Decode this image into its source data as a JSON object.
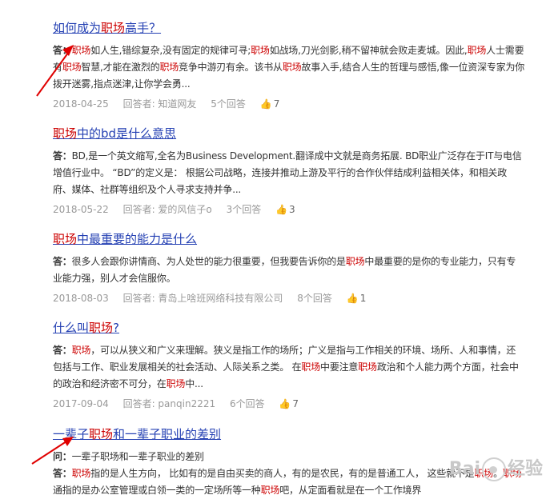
{
  "results": [
    {
      "title_parts": [
        "如何成为",
        "职场",
        "高手？"
      ],
      "body": [
        {
          "t": "答：",
          "c": "lbl"
        },
        {
          "t": "职场",
          "c": "hl"
        },
        {
          "t": "如人生,错综复杂,没有固定的规律可寻;"
        },
        {
          "t": "职场",
          "c": "hl"
        },
        {
          "t": "如战场,刀光剑影,稍不留神就会败走麦城。因此,"
        },
        {
          "t": "职场",
          "c": "hl"
        },
        {
          "t": "人士需要有"
        },
        {
          "t": "职场",
          "c": "hl"
        },
        {
          "t": "智慧,才能在激烈的"
        },
        {
          "t": "职场",
          "c": "hl"
        },
        {
          "t": "竞争中游刃有余。该书从"
        },
        {
          "t": "职场",
          "c": "hl"
        },
        {
          "t": "故事入手,结合人生的哲理与感悟,像一位资深专家为你拨开迷雾,指点迷津,让你学会勇..."
        }
      ],
      "date": "2018-04-25",
      "answerer": "回答者: 知道网友",
      "answers": "5个回答",
      "likes": "7"
    },
    {
      "title_parts": [
        "",
        "职场",
        "中的bd是什么意思"
      ],
      "body": [
        {
          "t": "答：",
          "c": "lbl"
        },
        {
          "t": "BD,是一个英文缩写,全名为Business Development.翻译成中文就是商务拓展. BD职业广泛存在于IT与电信增值行业中。 “BD”的定义是： 根据公司战略，连接并推动上游及平行的合作伙伴结成利益相关体，和相关政府、媒体、社群等组织及个人寻求支持并争..."
        }
      ],
      "date": "2018-05-22",
      "answerer": "回答者: 爱的风信子o",
      "answers": "3个回答",
      "likes": "3"
    },
    {
      "title_parts": [
        "",
        "职场",
        "中最重要的能力是什么"
      ],
      "body": [
        {
          "t": "答：",
          "c": "lbl"
        },
        {
          "t": "很多人会跟你讲情商、为人处世的能力很重要，但我要告诉你的是"
        },
        {
          "t": "职场",
          "c": "hl"
        },
        {
          "t": "中最重要的是你的专业能力，只有专业能力强，别人才会信服你。"
        }
      ],
      "date": "2018-08-03",
      "answerer": "回答者: 青岛上啥班网络科技有限公司",
      "answers": "8个回答",
      "likes": "1"
    },
    {
      "title_parts": [
        "什么叫",
        "职场",
        "?"
      ],
      "body": [
        {
          "t": "答：",
          "c": "lbl"
        },
        {
          "t": "职场",
          "c": "hl"
        },
        {
          "t": "，可以从狭义和广义来理解。狭义是指工作的场所；广义是指与工作相关的环境、场所、人和事情，还包括与工作、职业发展相关的社会活动、人际关系之类。 在"
        },
        {
          "t": "职场",
          "c": "hl"
        },
        {
          "t": "中要注意"
        },
        {
          "t": "职场",
          "c": "hl"
        },
        {
          "t": "政治和个人能力两个方面，社会中的政治和经济密不可分，在"
        },
        {
          "t": "职场",
          "c": "hl"
        },
        {
          "t": "中..."
        }
      ],
      "date": "2017-09-04",
      "answerer": "回答者: panqin2221",
      "answers": "6个回答",
      "likes": "7"
    },
    {
      "title_parts": [
        "一辈子",
        "职场",
        "和一辈子职业的差别"
      ],
      "body": [
        {
          "t": "问：",
          "c": "lbl"
        },
        {
          "t": "一辈子职场和一辈子职业的差别"
        },
        {
          "t": "\n"
        },
        {
          "t": "答：",
          "c": "lbl"
        },
        {
          "t": "职场",
          "c": "hl"
        },
        {
          "t": "指的是人生方向， 比如有的是自由买卖的商人，有的是农民，有的是普通工人， 这些就不是"
        },
        {
          "t": "职场",
          "c": "hl"
        },
        {
          "t": "。"
        },
        {
          "t": "职场",
          "c": "hl"
        },
        {
          "t": "通指的是办公室管理或白领一类的一定场所等一种"
        },
        {
          "t": "职场",
          "c": "hl"
        },
        {
          "t": "吧，从定面看就是在一个工作境界"
        }
      ],
      "date": "",
      "answerer": "",
      "answers": "",
      "likes": ""
    }
  ],
  "watermark": "Baidu 经验",
  "colors": {
    "link": "#2440b3",
    "highlight": "#c00",
    "meta": "#999",
    "arrow": "#e00000"
  }
}
